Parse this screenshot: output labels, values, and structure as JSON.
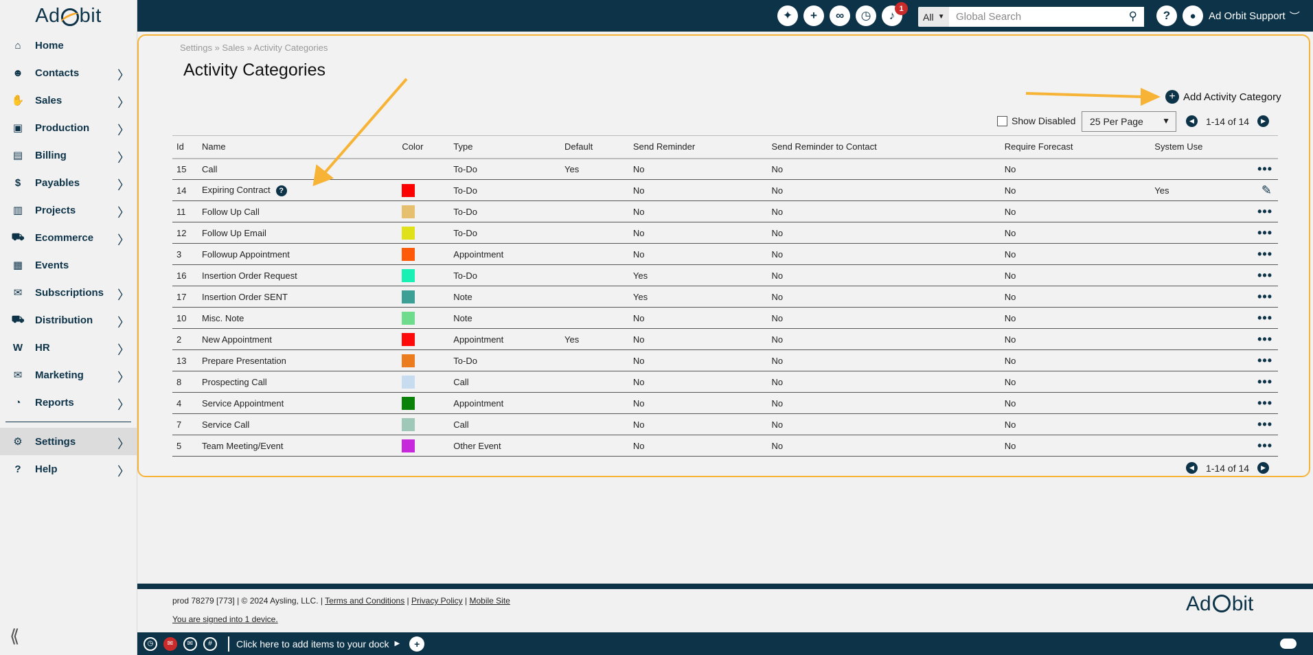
{
  "app": {
    "logo_text_left": "Ad",
    "logo_text_right": "bit"
  },
  "sidebar": {
    "items": [
      {
        "label": "Home",
        "icon": "home-icon"
      },
      {
        "label": "Contacts",
        "icon": "contacts-icon"
      },
      {
        "label": "Sales",
        "icon": "handshake-icon"
      },
      {
        "label": "Production",
        "icon": "image-icon"
      },
      {
        "label": "Billing",
        "icon": "invoice-icon"
      },
      {
        "label": "Payables",
        "icon": "money-icon"
      },
      {
        "label": "Projects",
        "icon": "clipboard-icon"
      },
      {
        "label": "Ecommerce",
        "icon": "cart-icon"
      },
      {
        "label": "Events",
        "icon": "calendar-icon"
      },
      {
        "label": "Subscriptions",
        "icon": "mailbox-icon"
      },
      {
        "label": "Distribution",
        "icon": "truck-icon"
      },
      {
        "label": "HR",
        "icon": "w2-icon"
      },
      {
        "label": "Marketing",
        "icon": "envelope-icon"
      },
      {
        "label": "Reports",
        "icon": "chart-icon"
      }
    ],
    "bottom_items": [
      {
        "label": "Settings",
        "icon": "gear-icon"
      },
      {
        "label": "Help",
        "icon": "question-icon"
      }
    ]
  },
  "topbar": {
    "notification_count": "1",
    "search_scope": "All",
    "search_placeholder": "Global Search",
    "user_name": "Ad Orbit Support"
  },
  "breadcrumb": "Settings » Sales » Activity Categories",
  "page_title": "Activity Categories",
  "add_button_label": "Add Activity Category",
  "show_disabled_label": "Show Disabled",
  "per_page": "25 Per Page",
  "pagination": "1-14 of 14",
  "table": {
    "headers": [
      "Id",
      "Name",
      "Color",
      "Type",
      "Default",
      "Send Reminder",
      "Send Reminder to Contact",
      "Require Forecast",
      "System Use"
    ],
    "rows": [
      {
        "id": "15",
        "name": "Call",
        "color": "",
        "type": "To-Do",
        "default": "Yes",
        "send_reminder": "No",
        "send_reminder_contact": "No",
        "require_forecast": "No",
        "system_use": "",
        "action": "more"
      },
      {
        "id": "14",
        "name": "Expiring Contract",
        "color": "#ff0000",
        "type": "To-Do",
        "default": "",
        "send_reminder": "No",
        "send_reminder_contact": "No",
        "require_forecast": "No",
        "system_use": "Yes",
        "action": "edit",
        "help": true
      },
      {
        "id": "11",
        "name": "Follow Up Call",
        "color": "#e6c06e",
        "type": "To-Do",
        "default": "",
        "send_reminder": "No",
        "send_reminder_contact": "No",
        "require_forecast": "No",
        "system_use": "",
        "action": "more"
      },
      {
        "id": "12",
        "name": "Follow Up Email",
        "color": "#e1e119",
        "type": "To-Do",
        "default": "",
        "send_reminder": "No",
        "send_reminder_contact": "No",
        "require_forecast": "No",
        "system_use": "",
        "action": "more"
      },
      {
        "id": "3",
        "name": "Followup Appointment",
        "color": "#ff5a0a",
        "type": "Appointment",
        "default": "",
        "send_reminder": "No",
        "send_reminder_contact": "No",
        "require_forecast": "No",
        "system_use": "",
        "action": "more"
      },
      {
        "id": "16",
        "name": "Insertion Order Request",
        "color": "#19f0b4",
        "type": "To-Do",
        "default": "",
        "send_reminder": "Yes",
        "send_reminder_contact": "No",
        "require_forecast": "No",
        "system_use": "",
        "action": "more"
      },
      {
        "id": "17",
        "name": "Insertion Order SENT",
        "color": "#3ca096",
        "type": "Note",
        "default": "",
        "send_reminder": "Yes",
        "send_reminder_contact": "No",
        "require_forecast": "No",
        "system_use": "",
        "action": "more"
      },
      {
        "id": "10",
        "name": "Misc. Note",
        "color": "#6edc8c",
        "type": "Note",
        "default": "",
        "send_reminder": "No",
        "send_reminder_contact": "No",
        "require_forecast": "No",
        "system_use": "",
        "action": "more"
      },
      {
        "id": "2",
        "name": "New Appointment",
        "color": "#ff0a0a",
        "type": "Appointment",
        "default": "Yes",
        "send_reminder": "No",
        "send_reminder_contact": "No",
        "require_forecast": "No",
        "system_use": "",
        "action": "more"
      },
      {
        "id": "13",
        "name": "Prepare Presentation",
        "color": "#eb7d1e",
        "type": "To-Do",
        "default": "",
        "send_reminder": "No",
        "send_reminder_contact": "No",
        "require_forecast": "No",
        "system_use": "",
        "action": "more"
      },
      {
        "id": "8",
        "name": "Prospecting Call",
        "color": "#c8dcf0",
        "type": "Call",
        "default": "",
        "send_reminder": "No",
        "send_reminder_contact": "No",
        "require_forecast": "No",
        "system_use": "",
        "action": "more"
      },
      {
        "id": "4",
        "name": "Service Appointment",
        "color": "#0a820a",
        "type": "Appointment",
        "default": "",
        "send_reminder": "No",
        "send_reminder_contact": "No",
        "require_forecast": "No",
        "system_use": "",
        "action": "more"
      },
      {
        "id": "7",
        "name": "Service Call",
        "color": "#a0c8b9",
        "type": "Call",
        "default": "",
        "send_reminder": "No",
        "send_reminder_contact": "No",
        "require_forecast": "No",
        "system_use": "",
        "action": "more"
      },
      {
        "id": "5",
        "name": "Team Meeting/Event",
        "color": "#c828dc",
        "type": "Other Event",
        "default": "",
        "send_reminder": "No",
        "send_reminder_contact": "No",
        "require_forecast": "No",
        "system_use": "",
        "action": "more"
      }
    ]
  },
  "footer": {
    "prefix": "prod 78279 [773] | © 2024 Aysling, LLC. |",
    "terms": "Terms and Conditions",
    "privacy": "Privacy Policy",
    "mobile": "Mobile Site",
    "signed_in": "You are signed into 1 device."
  },
  "dock": {
    "label": "Click here to add items to your dock"
  },
  "colors": {
    "brand": "#0d3349",
    "highlight": "#f7b335"
  }
}
